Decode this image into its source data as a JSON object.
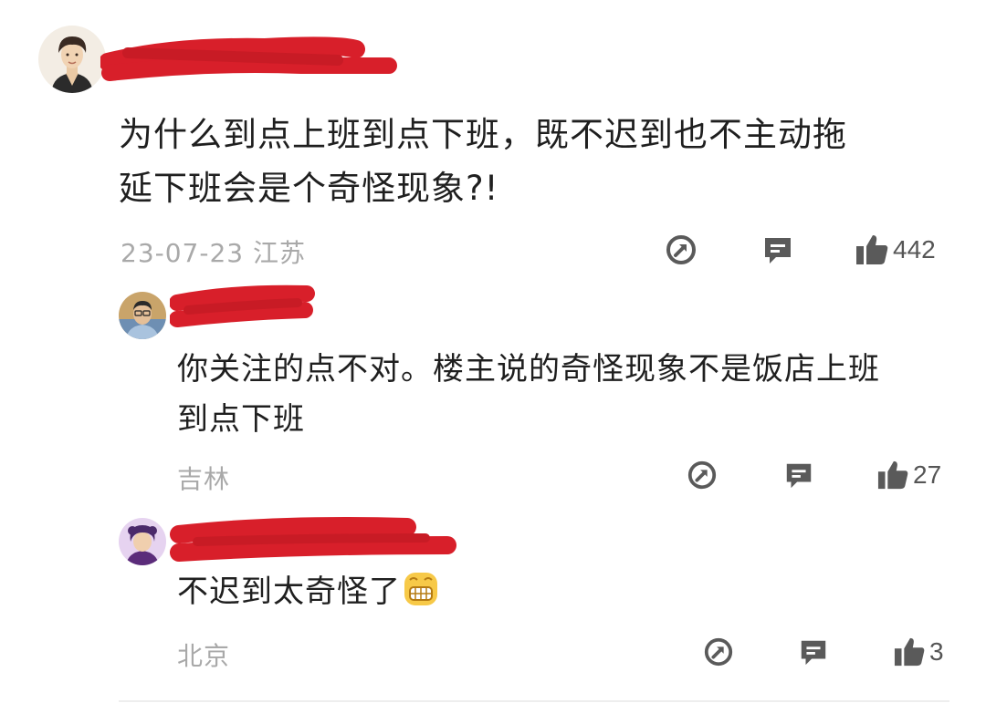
{
  "comments": [
    {
      "content_line1": "为什么到点上班到点下班，既不迟到也不主动拖",
      "content_line2": "延下班会是个奇怪现象?!",
      "date_location": "23-07-23 江苏",
      "likes": "442"
    },
    {
      "content_line1": "你关注的点不对。楼主说的奇怪现象不是饭店上班",
      "content_line2": "到点下班",
      "location": "吉林",
      "likes": "27"
    },
    {
      "content": "不迟到太奇怪了",
      "emoji": "grinning-emoji",
      "location": "北京",
      "likes": "3"
    }
  ],
  "icons": {
    "share": "share-icon",
    "reply": "comment-icon",
    "like": "thumbs-up-icon"
  },
  "colors": {
    "redaction": "#d81f2a",
    "meta_text": "#a9a9a9",
    "content_text": "#1f1f1f"
  }
}
